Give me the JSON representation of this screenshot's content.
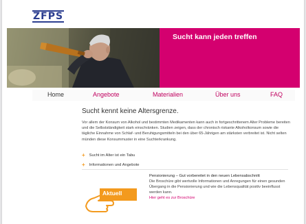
{
  "brand": {
    "logo_text": "ZFPS",
    "accent": "#d4006f",
    "logo_color": "#2b3d8f",
    "plus_color": "#f39a1e"
  },
  "hero": {
    "title": "Sucht kann jeden treffen",
    "image": "man-drinking-from-bottle-photo"
  },
  "nav": {
    "items": [
      {
        "label": "Home",
        "active": true
      },
      {
        "label": "Angebote",
        "active": false
      },
      {
        "label": "Materialien",
        "active": false
      },
      {
        "label": "Über uns",
        "active": false
      },
      {
        "label": "FAQ",
        "active": false
      }
    ]
  },
  "main": {
    "heading": "Sucht kennt keine Altersgrenze.",
    "lead": "Vor allem der Konsum von Alkohol und bestimmten Medikamenten kann auch in fortgeschrittenem Alter Probleme bereiten und die Selbstständigkeit stark einschränken. Studien zeigen, dass der chronisch riskante Alkoholkonsum sowie die tägliche Einnahme von Schlaf- und Beruhigungsmitteln bei den über 65-Jährigen am stärksten verbreitet ist. Nicht selten münden diese Konsummuster in eine Suchterkrankung.",
    "links": [
      {
        "label": "Sucht im Alter ist ein Tabu"
      },
      {
        "label": "Informationen und Angebote"
      }
    ],
    "plus_symbol": "+"
  },
  "aktuell": {
    "badge_label": "Aktuell",
    "title": "Pensionierung – Gut vorbereitet in den neuen Lebensabschnitt",
    "text": "Die Broschüre gibt wertvolle Informationen und Anregungen für einen gesunden Übergang in die Pensionierung und wie die Lebensqualität positiv beeinflusst werden kann.",
    "link": "Hier geht es zur Broschüre"
  }
}
